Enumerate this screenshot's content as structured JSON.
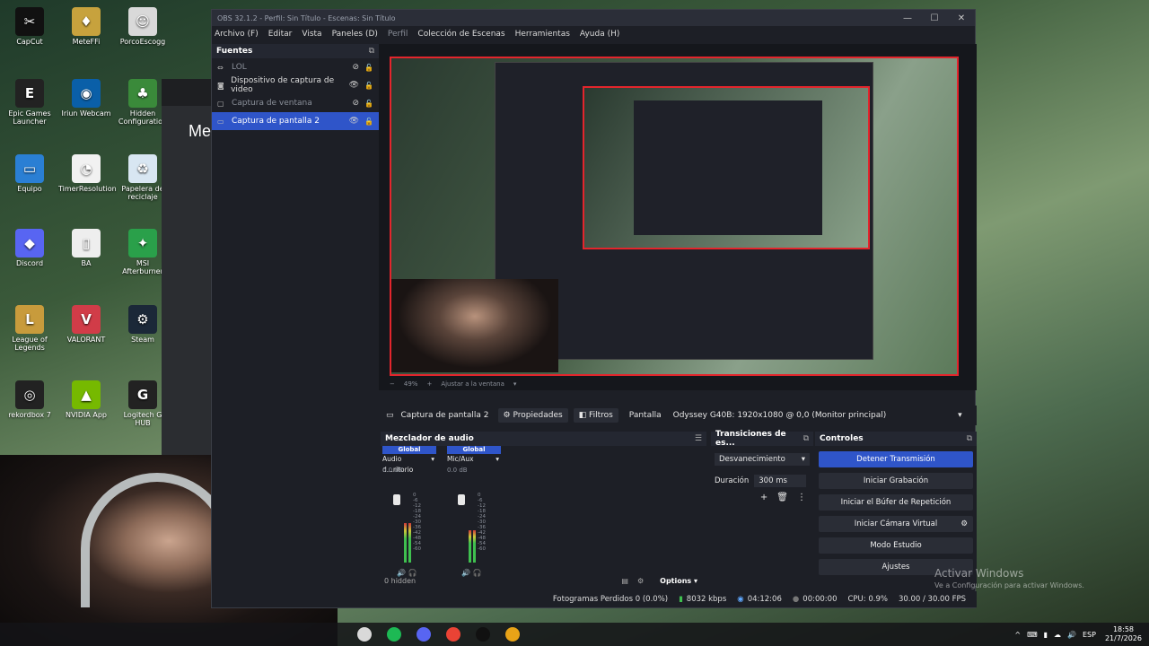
{
  "desktop": {
    "icons": [
      {
        "label": "CapCut",
        "glyph": "✂",
        "color": "#111"
      },
      {
        "label": "MeteFFi",
        "glyph": "♦",
        "color": "#c7a23d"
      },
      {
        "label": "PorcoEscogg",
        "glyph": "☺",
        "color": "#d9d9d9"
      },
      {
        "label": "Epic Games Launcher",
        "glyph": "E",
        "color": "#222"
      },
      {
        "label": "Iriun Webcam",
        "glyph": "◉",
        "color": "#0a5fa8"
      },
      {
        "label": "Hidden Configuration",
        "glyph": "♣",
        "color": "#3a8a3a"
      },
      {
        "label": "Equipo",
        "glyph": "▭",
        "color": "#2a7fd4"
      },
      {
        "label": "TimerResolution",
        "glyph": "◔",
        "color": "#f1f1f1"
      },
      {
        "label": "Papelera de reciclaje",
        "glyph": "♻",
        "color": "#d8e6f2"
      },
      {
        "label": "Discord",
        "glyph": "◆",
        "color": "#5865f2"
      },
      {
        "label": "BA",
        "glyph": "▯",
        "color": "#eee"
      },
      {
        "label": "MSI Afterburner",
        "glyph": "✦",
        "color": "#2aa04a"
      },
      {
        "label": "League of Legends",
        "glyph": "L",
        "color": "#c89b3c"
      },
      {
        "label": "VALORANT",
        "glyph": "V",
        "color": "#d13c48"
      },
      {
        "label": "Steam",
        "glyph": "⚙",
        "color": "#1b2838"
      },
      {
        "label": "rekordbox 7",
        "glyph": "◎",
        "color": "#222"
      },
      {
        "label": "NVIDIA App",
        "glyph": "▲",
        "color": "#76b900"
      },
      {
        "label": "Logitech G HUB",
        "glyph": "G",
        "color": "#222"
      }
    ],
    "bg_app_title": "Me"
  },
  "obs": {
    "title": "OBS 32.1.2 - Perfil: Sin Título - Escenas: Sin Título",
    "window_controls": [
      "—",
      "☐",
      "✕"
    ],
    "menu": [
      {
        "label": "Archivo (F)",
        "dim": false
      },
      {
        "label": "Editar",
        "dim": false
      },
      {
        "label": "Vista",
        "dim": false
      },
      {
        "label": "Paneles (D)",
        "dim": false
      },
      {
        "label": "Perfil",
        "dim": true
      },
      {
        "label": "Colección de Escenas",
        "dim": false
      },
      {
        "label": "Herramientas",
        "dim": false
      },
      {
        "label": "Ayuda (H)",
        "dim": false
      }
    ],
    "sources": {
      "title": "Fuentes",
      "items": [
        {
          "label": "LOL",
          "icon": "link-icon",
          "visible": false,
          "state": "dim"
        },
        {
          "label": "Dispositivo de captura de video",
          "icon": "camera-icon",
          "visible": true,
          "state": "normal"
        },
        {
          "label": "Captura de ventana",
          "icon": "window-icon",
          "visible": false,
          "state": "dim"
        },
        {
          "label": "Captura de pantalla 2",
          "icon": "monitor-icon",
          "visible": true,
          "state": "selected"
        }
      ]
    },
    "preview": {
      "zoom": "49%",
      "zoom_fit": "Ajustar a la ventana"
    },
    "source_toolbar": {
      "source_name": "Captura de pantalla 2",
      "properties": "Propiedades",
      "filters": "Filtros",
      "display_label": "Pantalla",
      "display_value": "Odyssey G40B: 1920x1080 @ 0,0 (Monitor principal)"
    },
    "mixer": {
      "title": "Mezclador de audio",
      "channels": [
        {
          "badge": "Global",
          "name": "Audio d...ritorio",
          "db": "0.0 dB",
          "level": 0.55
        },
        {
          "badge": "Global",
          "name": "Mic/Aux",
          "db": "0.0 dB",
          "level": 0.45
        }
      ],
      "scale": [
        "0",
        "-6",
        "-12",
        "-18",
        "-24",
        "-30",
        "-36",
        "-42",
        "-48",
        "-54",
        "-60"
      ],
      "hidden": "0 hidden",
      "options": "Options"
    },
    "transitions": {
      "title": "Transiciones de es...",
      "selected": "Desvanecimiento",
      "duration_label": "Duración",
      "duration_value": "300 ms"
    },
    "controls": {
      "title": "Controles",
      "buttons": [
        {
          "label": "Detener Transmisión",
          "primary": true
        },
        {
          "label": "Iniciar Grabación",
          "primary": false
        },
        {
          "label": "Iniciar el Búfer de Repetición",
          "primary": false
        },
        {
          "label": "Iniciar Cámara Virtual",
          "primary": false
        },
        {
          "label": "Modo Estudio",
          "primary": false
        },
        {
          "label": "Ajustes",
          "primary": false
        }
      ]
    },
    "status": {
      "dropped": "Fotogramas Perdidos 0 (0.0%)",
      "bitrate": "8032 kbps",
      "stream_time": "04:12:06",
      "rec_time": "00:00:00",
      "cpu": "CPU: 0.9%",
      "fps": "30.00 / 30.00 FPS"
    }
  },
  "watermark": {
    "line1": "Activar Windows",
    "line2": "Ve a Configuración para activar Windows."
  },
  "taskbar": {
    "apps": [
      "#d9d9d9",
      "#1db954",
      "#5865f2",
      "#ea4335",
      "#111",
      "#e8a317"
    ],
    "tray": [
      "^",
      "⌨",
      "▮",
      "☁",
      "🔊",
      "ESP"
    ],
    "time": "18:58",
    "date": "21/7/2026"
  }
}
